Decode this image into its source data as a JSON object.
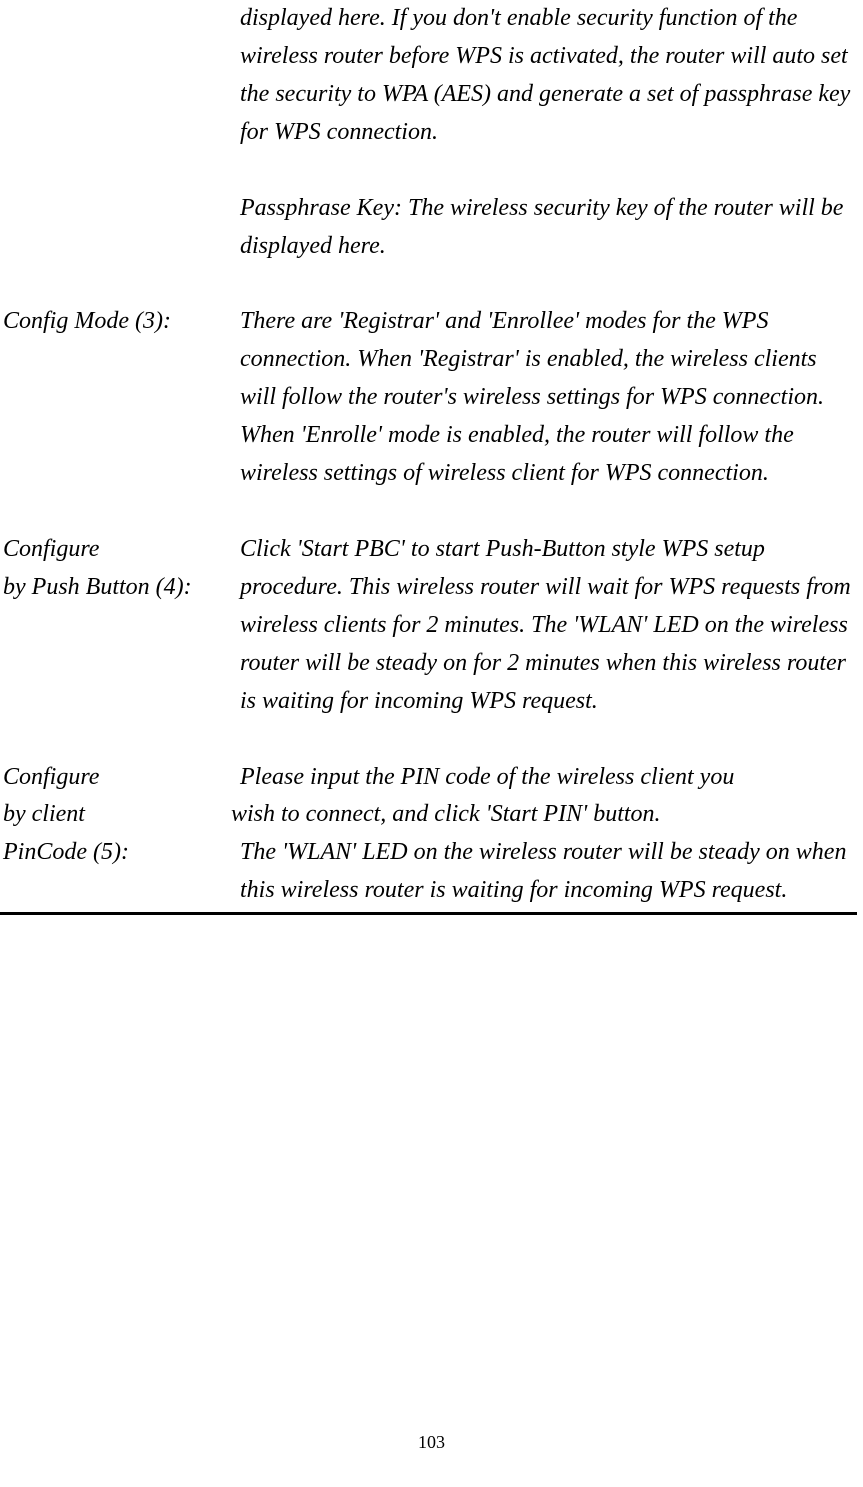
{
  "section1": {
    "label": "",
    "desc_part1": "displayed here. If you don't enable security function of the wireless router before WPS is activated, the router will auto set the security to WPA (AES) and generate a set of passphrase key for WPS connection.",
    "desc_part2": "Passphrase Key: The wireless security key of the router will be displayed here."
  },
  "section2": {
    "label": "Config Mode (3):",
    "desc": "There are 'Registrar' and 'Enrollee' modes for the WPS connection. When 'Registrar' is enabled, the wireless clients will follow the router's wireless settings for WPS connection. When 'Enrolle' mode is enabled, the router will follow the wireless settings of wireless client for WPS connection."
  },
  "section3": {
    "label_line1": "Configure",
    "label_line2": "by Push Button (4):",
    "desc": "Click 'Start PBC' to start Push-Button style WPS setup procedure. This wireless router will wait for WPS requests from wireless clients for 2 minutes. The 'WLAN' LED on the wireless router will be steady on for 2 minutes when this wireless router is waiting for incoming WPS request."
  },
  "section4": {
    "label_line1": "Configure",
    "label_line2": "by client",
    "label_line3": "PinCode (5):",
    "desc_line1": "Please input the PIN code of the wireless client you",
    "desc_line2_prefix": "wish to connect, and click 'Start PIN' button.",
    "desc_rest": "The 'WLAN' LED on the wireless router will be steady on when this wireless router is waiting for incoming WPS request."
  },
  "page_number": "103"
}
